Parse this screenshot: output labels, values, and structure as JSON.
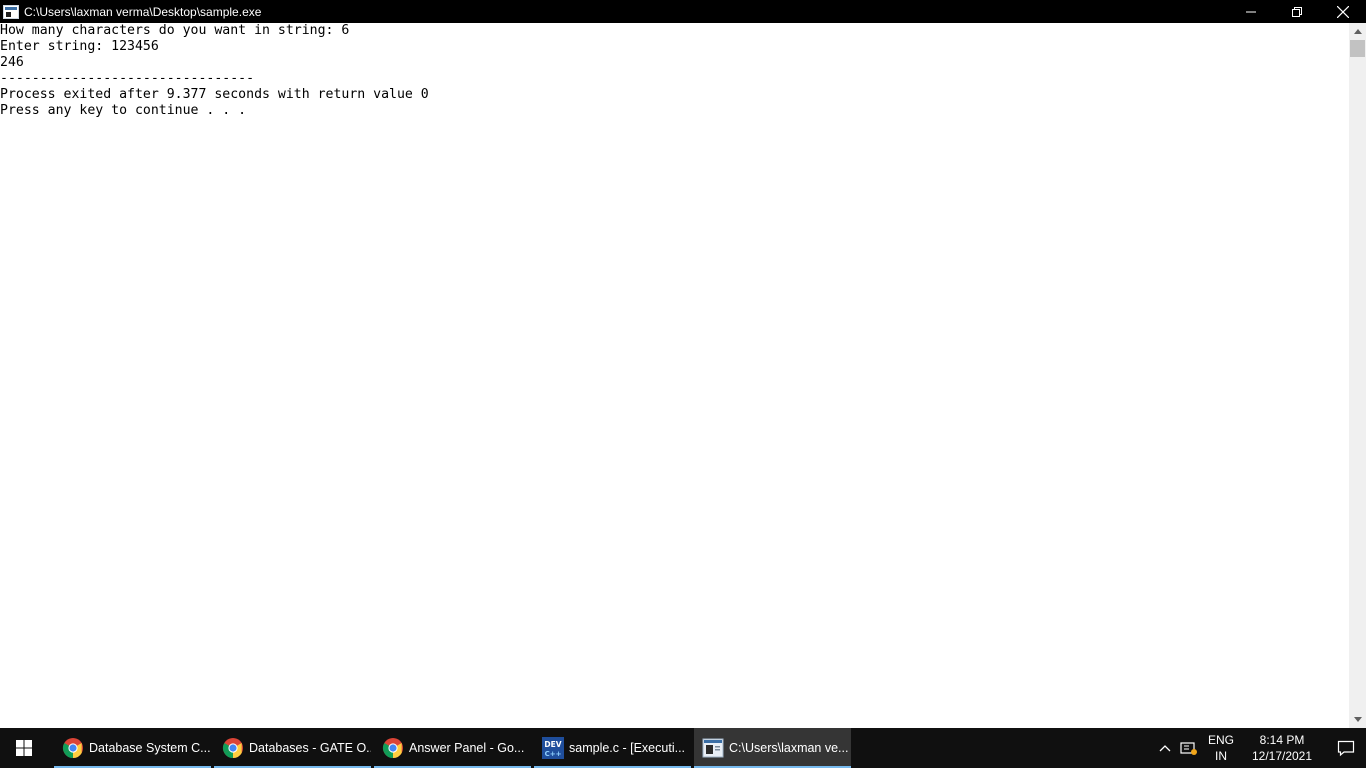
{
  "window": {
    "title": "C:\\Users\\laxman verma\\Desktop\\sample.exe",
    "controls": {
      "minimize_icon": "minimize-icon",
      "maximize_icon": "restore-icon",
      "close_icon": "close-icon"
    }
  },
  "console": {
    "lines": [
      "How many characters do you want in string: 6",
      "Enter string: 123456",
      "246",
      "--------------------------------",
      "Process exited after 9.377 seconds with return value 0",
      "Press any key to continue . . ."
    ]
  },
  "taskbar": {
    "start_icon": "windows-logo-icon",
    "items": [
      {
        "label": "Database System C...",
        "icon": "chrome-icon",
        "active": false
      },
      {
        "label": "Databases - GATE O...",
        "icon": "chrome-icon",
        "active": false
      },
      {
        "label": "Answer Panel - Go...",
        "icon": "chrome-icon",
        "active": false
      },
      {
        "label": "sample.c - [Executi...",
        "icon": "dev-cpp-icon",
        "active": false
      },
      {
        "label": "C:\\Users\\laxman ve...",
        "icon": "console-icon",
        "active": true
      }
    ],
    "tray": {
      "language_line1": "ENG",
      "language_line2": "IN",
      "time": "8:14 PM",
      "date": "12/17/2021"
    }
  },
  "colors": {
    "console_bg": "#ffffff",
    "titlebar_bg": "#000000",
    "taskbar_bg": "#101010",
    "active_underline": "#76b9ed"
  }
}
